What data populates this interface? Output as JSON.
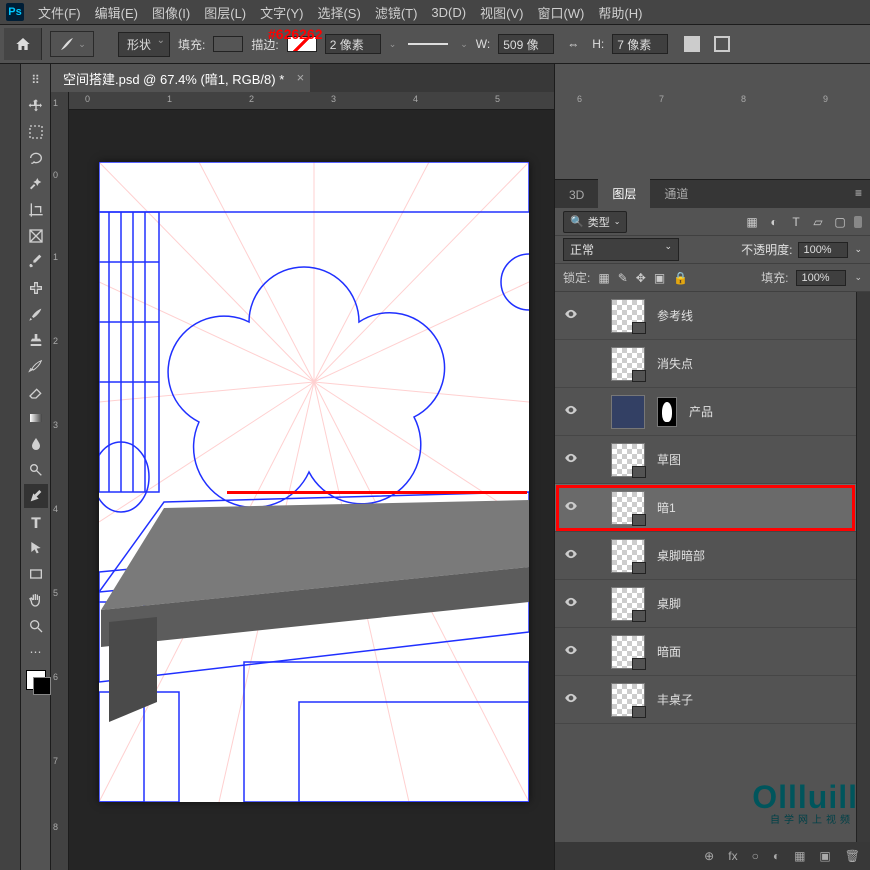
{
  "logo": "Ps",
  "menus": [
    "文件(F)",
    "编辑(E)",
    "图像(I)",
    "图层(L)",
    "文字(Y)",
    "选择(S)",
    "滤镜(T)",
    "3D(D)",
    "视图(V)",
    "窗口(W)",
    "帮助(H)"
  ],
  "color_annotation": "#626262",
  "options": {
    "shape_mode": "形状",
    "fill_label": "填充:",
    "stroke_label": "描边:",
    "stroke_width": "2 像素",
    "w_label": "W:",
    "w_value": "509 像",
    "h_label": "H:",
    "h_value": "7 像素"
  },
  "doc_tab": "空间搭建.psd @ 67.4% (暗1, RGB/8) *",
  "hruler_ticks": [
    "0",
    "1",
    "2",
    "3",
    "4",
    "5",
    "6",
    "7",
    "8",
    "9"
  ],
  "vruler_ticks": [
    "1",
    "0",
    "1",
    "2",
    "3",
    "4",
    "5",
    "6",
    "7",
    "8"
  ],
  "panel_tabs": [
    "3D",
    "图层",
    "通道"
  ],
  "filter_label": "类型",
  "blend_mode": "正常",
  "opacity_label": "不透明度:",
  "opacity_value": "100%",
  "lock_label": "锁定:",
  "fill_opacity_label": "填充:",
  "fill_opacity_value": "100%",
  "layers": [
    {
      "name": "参考线",
      "visible": true,
      "thumb": "check"
    },
    {
      "name": "消失点",
      "visible": false,
      "thumb": "check"
    },
    {
      "name": "产品",
      "visible": true,
      "thumb": "image",
      "mask": true
    },
    {
      "name": "草图",
      "visible": true,
      "thumb": "check"
    },
    {
      "name": "暗1",
      "visible": true,
      "thumb": "check",
      "selected": true,
      "highlight": true
    },
    {
      "name": "桌脚暗部",
      "visible": true,
      "thumb": "check"
    },
    {
      "name": "桌脚",
      "visible": true,
      "thumb": "check"
    },
    {
      "name": "暗面",
      "visible": true,
      "thumb": "check"
    },
    {
      "name": "丰桌子",
      "visible": true,
      "thumb": "check"
    }
  ],
  "footer_icons": [
    "⊕",
    "fx",
    "○",
    "◐",
    "▦",
    "▣",
    "🗑"
  ],
  "watermark": "Ollluill",
  "watermark_sub": "自学网上视频"
}
